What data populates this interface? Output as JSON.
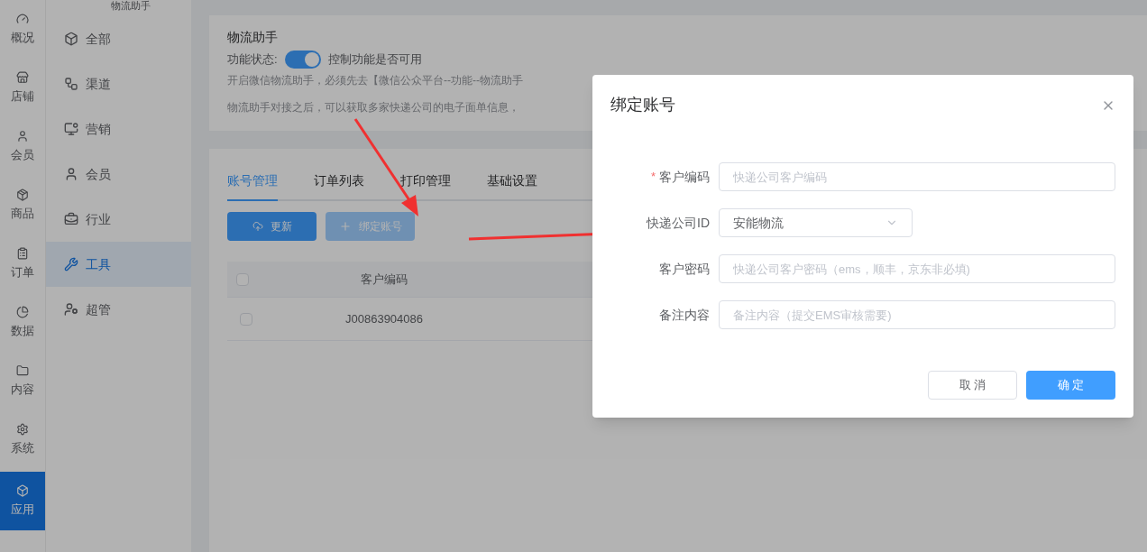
{
  "rail": [
    {
      "label": "概况",
      "selected": false
    },
    {
      "label": "店铺",
      "selected": false
    },
    {
      "label": "会员",
      "selected": false
    },
    {
      "label": "商品",
      "selected": false
    },
    {
      "label": "订单",
      "selected": false
    },
    {
      "label": "数据",
      "selected": false
    },
    {
      "label": "内容",
      "selected": false
    },
    {
      "label": "系统",
      "selected": false
    },
    {
      "label": "应用",
      "selected": true
    }
  ],
  "submenu": {
    "title": "物流助手",
    "items": [
      {
        "label": "全部",
        "selected": false
      },
      {
        "label": "渠道",
        "selected": false
      },
      {
        "label": "营销",
        "selected": false
      },
      {
        "label": "会员",
        "selected": false
      },
      {
        "label": "行业",
        "selected": false
      },
      {
        "label": "工具",
        "selected": true
      },
      {
        "label": "超管",
        "selected": false
      }
    ]
  },
  "intro": {
    "title": "物流助手",
    "status_label": "功能状态:",
    "switch_on": true,
    "switch_hint": "控制功能是否可用",
    "lines": [
      "开启微信物流助手，必须先去【微信公众平台--功能--物流助手",
      "物流助手对接之后，可以获取多家快递公司的电子面单信息，"
    ]
  },
  "tabs": [
    {
      "label": "账号管理",
      "selected": true
    },
    {
      "label": "订单列表",
      "selected": false
    },
    {
      "label": "打印管理",
      "selected": false
    },
    {
      "label": "基础设置",
      "selected": false
    }
  ],
  "toolbar": [
    {
      "label": "更新",
      "kind": "primary"
    },
    {
      "label": "绑定账号",
      "kind": "light"
    }
  ],
  "table": {
    "header_checked": false,
    "columns": [
      "客户编码"
    ],
    "rows": [
      {
        "checked": false,
        "cells": [
          "J00863904086"
        ]
      }
    ]
  },
  "dialog": {
    "title": "绑定账号",
    "fields": [
      {
        "kind": "input",
        "label": "客户编码",
        "required_mark": "*",
        "placeholder": "快递公司客户编码"
      },
      {
        "kind": "select",
        "label": "快递公司ID",
        "value": "安能物流"
      },
      {
        "kind": "input",
        "label": "客户密码",
        "placeholder": "快递公司客户密码（ems，顺丰，京东非必填)"
      },
      {
        "kind": "input",
        "label": "备注内容",
        "placeholder": "备注内容（提交EMS审核需要)"
      }
    ],
    "buttons": [
      {
        "label": "取 消",
        "kind": "default"
      },
      {
        "label": "确 定",
        "kind": "primary"
      }
    ]
  }
}
